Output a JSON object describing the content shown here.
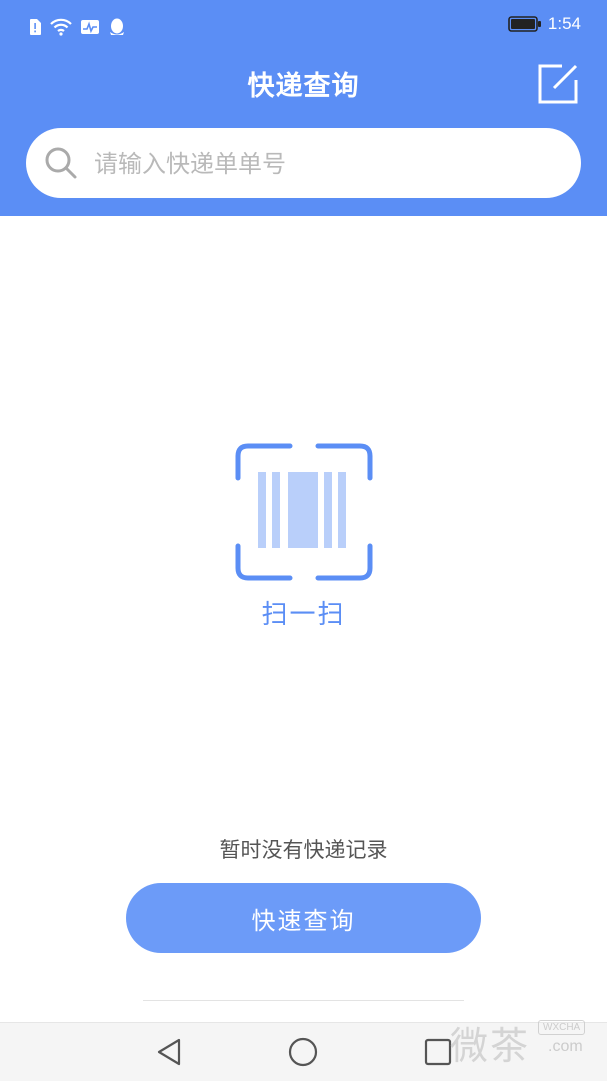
{
  "status_bar": {
    "time": "1:54",
    "icons": [
      "sim-alert-icon",
      "wifi-icon",
      "activity-icon",
      "qq-icon",
      "battery-icon"
    ]
  },
  "header": {
    "title": "快递查询",
    "edit_icon": "edit-icon",
    "background_color": "#5b8ef5"
  },
  "search": {
    "placeholder": "请输入快递单单号",
    "value": "",
    "icon": "search-icon"
  },
  "scan": {
    "icon": "barcode-scan-icon",
    "label": "扫一扫",
    "accent_color": "#5b8ef5"
  },
  "empty_state": {
    "message": "暂时没有快递记录"
  },
  "primary_action": {
    "label": "快速查询",
    "color": "#6c9bf8"
  },
  "nav_bar": {
    "buttons": [
      "back-icon",
      "home-icon",
      "recents-icon"
    ]
  },
  "watermark": {
    "text": "微茶",
    "tag": "WXCHA",
    "suffix": ".com"
  }
}
